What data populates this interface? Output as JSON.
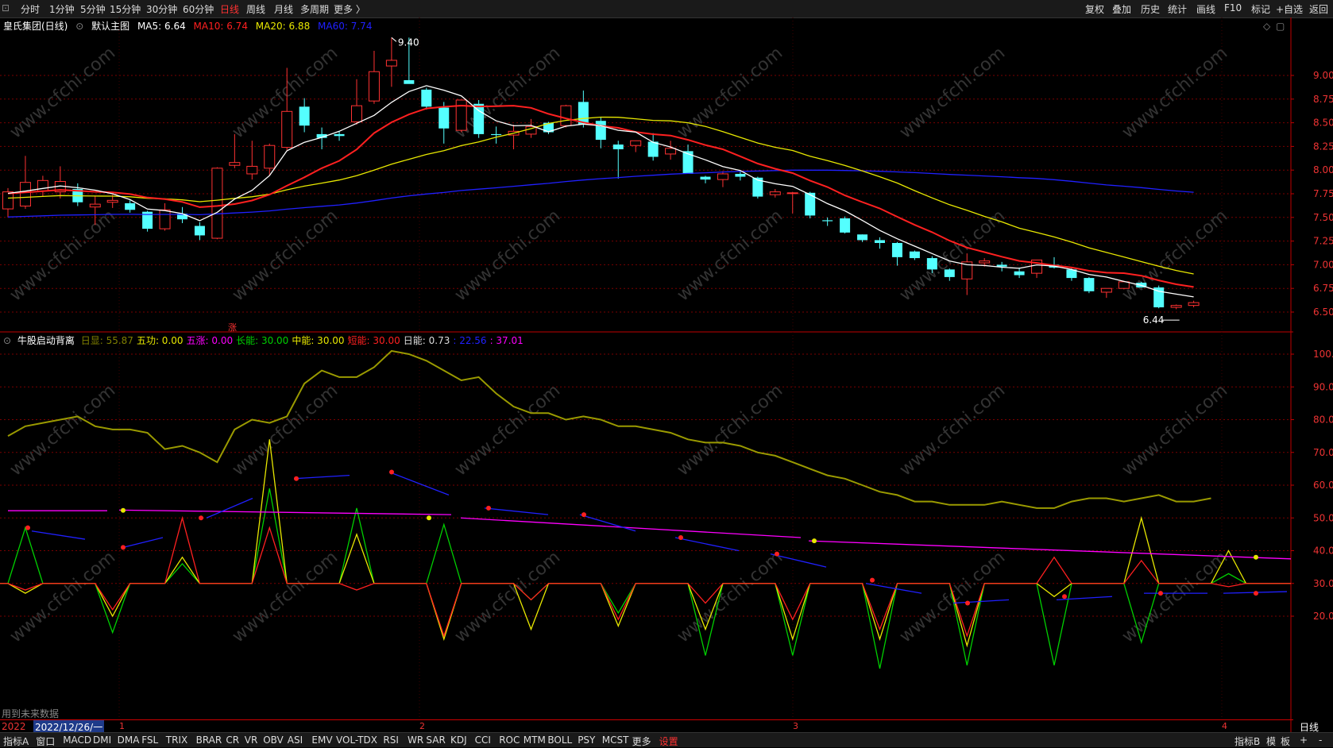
{
  "topbar": {
    "left_items": [
      "分时",
      "1分钟",
      "5分钟",
      "15分钟",
      "30分钟",
      "60分钟",
      "日线",
      "周线",
      "月线",
      "多周期",
      "更多 〉"
    ],
    "active_index": 6,
    "right_items": [
      "复权",
      "叠加",
      "历史",
      "统计",
      "画线",
      "F10",
      "标记",
      "+自选",
      "返回"
    ]
  },
  "main_chart": {
    "title": "皇氏集团(日线)",
    "layout_name": "默认主图",
    "ma5": "MA5: 6.64",
    "ma10": "MA10: 6.74",
    "ma20": "MA20: 6.88",
    "ma60": "MA60: 7.74",
    "high_label": "9.40",
    "low_label": "6.44",
    "zhang_label": "涨",
    "y_labels": [
      "9.00",
      "8.75",
      "8.50",
      "8.25",
      "8.00",
      "7.75",
      "7.50",
      "7.25",
      "7.00",
      "6.75",
      "6.50"
    ]
  },
  "indicator": {
    "name": "牛股启动背离",
    "items": [
      {
        "text": "日显: 55.87",
        "color": "#808000"
      },
      {
        "text": "五功: 0.00",
        "color": "#e8e800"
      },
      {
        "text": "五涨: 0.00",
        "color": "#ff00ff"
      },
      {
        "text": "长能: 30.00",
        "color": "#00d000"
      },
      {
        "text": "中能: 30.00",
        "color": "#e8e800"
      },
      {
        "text": "短能: 30.00",
        "color": "#ff2020"
      },
      {
        "text": "日能: 0.73",
        "color": "#dddddd"
      },
      {
        "text": ": 22.56",
        "color": "#2020ff"
      },
      {
        "text": ": 37.01",
        "color": "#ff00ff"
      }
    ],
    "y_labels": [
      "100.0",
      "90.00",
      "80.00",
      "70.00",
      "60.00",
      "50.00",
      "40.00",
      "30.00",
      "20.00"
    ],
    "footer_note": "用到未来数据"
  },
  "datebar": {
    "selected_date": "2022/12/26/一",
    "prefix": "2022",
    "months": [
      "1",
      "2",
      "3",
      "4"
    ],
    "period_label": "日线"
  },
  "bottom_tabs": [
    "指标A",
    "窗口",
    "MACD",
    "DMI",
    "DMA",
    "FSL",
    "TRIX",
    "BRAR",
    "CR",
    "VR",
    "OBV",
    "ASI",
    "EMV",
    "VOL-TDX",
    "RSI",
    "WR",
    "SAR",
    "KDJ",
    "CCI",
    "ROC",
    "MTM",
    "BOLL",
    "PSY",
    "MCST",
    "更多",
    "设置"
  ],
  "bottom_right": [
    "指标B",
    "模",
    "板",
    "+",
    "-"
  ],
  "watermark": "www.cfchi.com",
  "colors": {
    "up": "#ff3232",
    "down": "#54ffff",
    "ma5": "#ffffff",
    "ma10": "#ff2020",
    "ma20": "#e8e800",
    "ma60": "#2020ff",
    "grid": "#7a0000",
    "axis": "#c00000"
  }
}
